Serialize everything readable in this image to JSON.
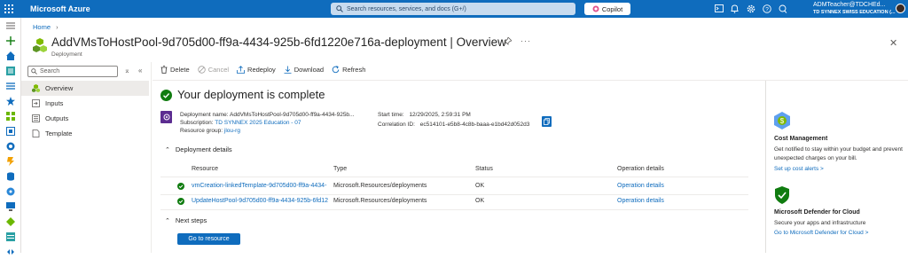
{
  "topbar": {
    "brand": "Microsoft Azure",
    "search_placeholder": "Search resources, services, and docs (G+/)",
    "copilot_label": "Copilot",
    "account_name": "ADMTeacher@TDCHEd...",
    "account_org": "TD SYNNEX SWISS EDUCATION (...",
    "accent": "#0f6cbd"
  },
  "breadcrumb": {
    "home": "Home"
  },
  "header": {
    "title": "AddVMsToHostPool-9d705d00-ff9a-4434-925b-6fd1220e716a-deployment",
    "separator": "|",
    "view": "Overview",
    "subtitle": "Deployment"
  },
  "resource_menu": {
    "search_placeholder": "Search",
    "items": [
      {
        "label": "Overview",
        "icon": "overview-icon",
        "active": true
      },
      {
        "label": "Inputs",
        "icon": "inputs-icon"
      },
      {
        "label": "Outputs",
        "icon": "outputs-icon"
      },
      {
        "label": "Template",
        "icon": "template-icon"
      }
    ]
  },
  "toolbar": {
    "delete": "Delete",
    "cancel": "Cancel",
    "redeploy": "Redeploy",
    "download": "Download",
    "refresh": "Refresh"
  },
  "status": {
    "heading": "Your deployment is complete",
    "color": "#107c10"
  },
  "deployment_info": {
    "name_label": "Deployment name:",
    "name_value": "AddVMsToHostPool-9d705d00-ff9a-4434-925b...",
    "subscription_label": "Subscription:",
    "subscription_value": "TD SYNNEX 2025 Education - 07",
    "rg_label": "Resource group:",
    "rg_value": "jlou-rg",
    "start_label": "Start time:",
    "start_value": "12/29/2025, 2:59:31 PM",
    "corr_label": "Correlation ID:",
    "corr_value": "ec514101-e5b8-4c8b-baaa-e1bd42d052d3"
  },
  "details": {
    "heading": "Deployment details",
    "columns": [
      "Resource",
      "Type",
      "Status",
      "Operation details"
    ],
    "rows": [
      {
        "resource": "vmCreation-linkedTemplate-9d705d00-ff9a-4434-",
        "type": "Microsoft.Resources/deployments",
        "status": "OK",
        "op": "Operation details"
      },
      {
        "resource": "UpdateHostPool-9d705d00-ff9a-4434-925b-6fd12",
        "type": "Microsoft.Resources/deployments",
        "status": "OK",
        "op": "Operation details"
      }
    ]
  },
  "next_steps": {
    "heading": "Next steps",
    "button": "Go to resource"
  },
  "right_panel": {
    "cards": [
      {
        "title": "Cost Management",
        "text": "Get notified to stay within your budget and prevent unexpected charges on your bill.",
        "link": "Set up cost alerts >",
        "icon": "cost-management-icon"
      },
      {
        "title": "Microsoft Defender for Cloud",
        "text": "Secure your apps and infrastructure",
        "link": "Go to Microsoft Defender for Cloud >",
        "icon": "defender-shield-icon"
      }
    ]
  }
}
